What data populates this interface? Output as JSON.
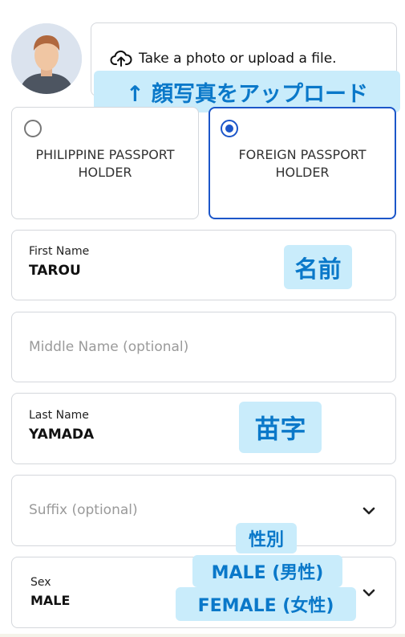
{
  "upload": {
    "label": "Take a photo or upload a file."
  },
  "annotations": {
    "upload_note": "↑ 顔写真をアップロード",
    "first_name_note": "名前",
    "last_name_note": "苗字",
    "sex_note": "性別",
    "male_note": "MALE (男性)",
    "female_note": "FEMALE (女性)"
  },
  "passport_options": [
    {
      "line1": "PHILIPPINE PASSPORT",
      "line2": "HOLDER",
      "selected": false
    },
    {
      "line1": "FOREIGN PASSPORT",
      "line2": "HOLDER",
      "selected": true
    }
  ],
  "fields": {
    "first_name": {
      "label": "First Name",
      "value": "TAROU"
    },
    "middle_name": {
      "placeholder": "Middle Name (optional)"
    },
    "last_name": {
      "label": "Last Name",
      "value": "YAMADA"
    },
    "suffix": {
      "placeholder": "Suffix (optional)"
    },
    "sex": {
      "label": "Sex",
      "value": "MALE"
    }
  },
  "colors": {
    "accent": "#1c56c9",
    "annotation_bg": "#c9ecfb",
    "annotation_text": "#0a78c9"
  },
  "icons": {
    "upload": "cloud-upload-icon",
    "chevron": "chevron-down-icon"
  }
}
